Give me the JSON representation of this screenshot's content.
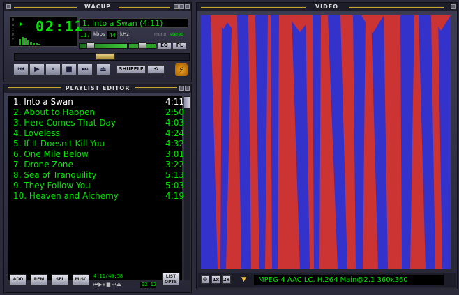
{
  "colors": {
    "lcd_green": "#00e600",
    "video_red": "#cc3333",
    "video_blue": "#3333cc"
  },
  "player": {
    "title": "WACUP",
    "time": "02:12",
    "play_state_icon": "play-icon",
    "song_display": "1. Into a Swan (4:11)",
    "kbps_value": "117",
    "kbps_label": "kbps",
    "khz_value": "44",
    "khz_label": "kHz",
    "mono_label": "mono",
    "stereo_label": "stereo",
    "eq_label": "EQ",
    "pl_label": "PL",
    "shuffle_label": "SHUFFLE",
    "volume_level": 0.7,
    "balance_level": 0.5,
    "seek_position": 0.52
  },
  "playlist": {
    "title": "PLAYLIST EDITOR",
    "items": [
      {
        "title": "1. Into a Swan",
        "duration": "4:11",
        "current": true
      },
      {
        "title": "2. About to Happen",
        "duration": "2:50"
      },
      {
        "title": "3. Here Comes That Day",
        "duration": "4:03"
      },
      {
        "title": "4. Loveless",
        "duration": "4:24"
      },
      {
        "title": "5. If It Doesn't Kill You",
        "duration": "4:32"
      },
      {
        "title": "6. One Mile Below",
        "duration": "3:01"
      },
      {
        "title": "7. Drone Zone",
        "duration": "3:22"
      },
      {
        "title": "8. Sea of Tranquility",
        "duration": "5:13"
      },
      {
        "title": "9. They Follow You",
        "duration": "5:03"
      },
      {
        "title": "10. Heaven and Alchemy",
        "duration": "4:19"
      }
    ],
    "buttons": {
      "add": "ADD",
      "rem": "REM",
      "sel": "SEL",
      "misc": "MISC",
      "list_opts": "LIST OPTS"
    },
    "total_time": "4:11/40:58",
    "mini_time": "02:12"
  },
  "video": {
    "title": "VIDEO",
    "info": "MPEG-4 AAC LC, H.264 Main@2.1 360x360",
    "zoom_1x": "1x",
    "zoom_2x": "2x"
  }
}
